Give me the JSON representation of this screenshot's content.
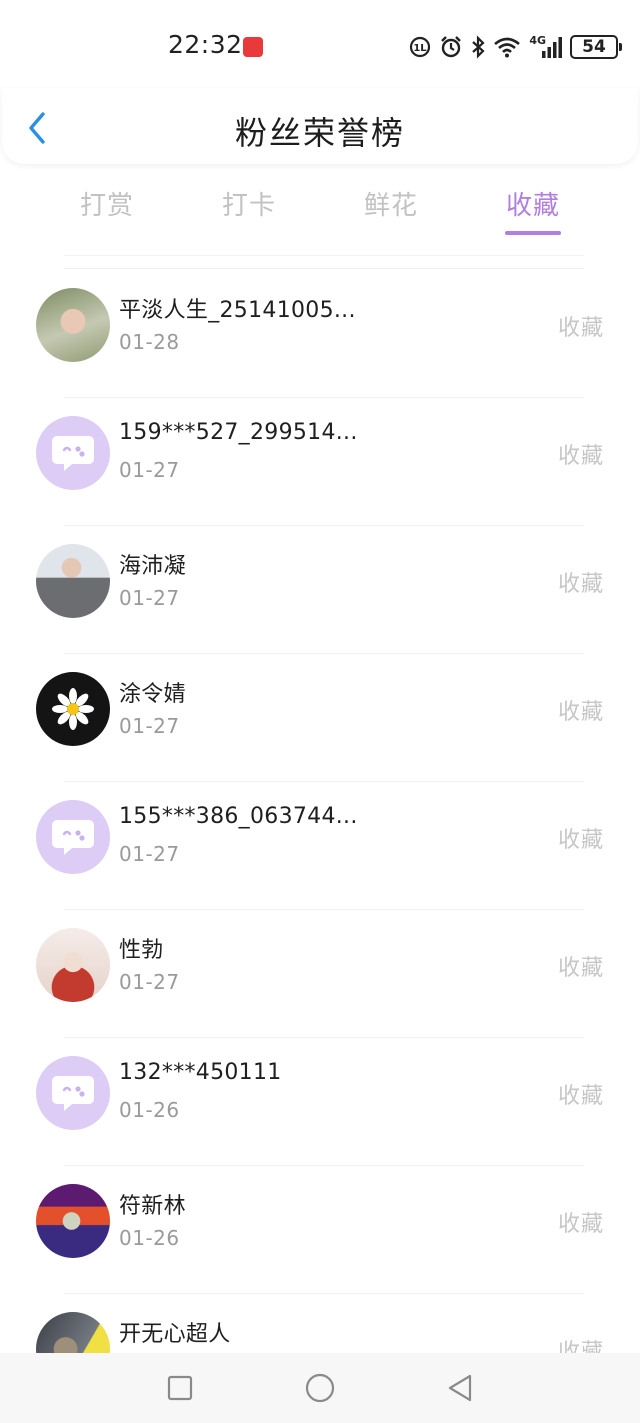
{
  "status_bar": {
    "time": "22:32",
    "battery": "54",
    "network": "4G",
    "icons": [
      "app-badge-icon",
      "hd-volte-icon",
      "alarm-icon",
      "bluetooth-icon",
      "wifi-icon",
      "signal-icon",
      "battery-icon"
    ]
  },
  "header": {
    "title": "粉丝荣誉榜",
    "back_icon": "chevron-left-icon"
  },
  "tabs": [
    {
      "label": "打赏",
      "active": false
    },
    {
      "label": "打卡",
      "active": false
    },
    {
      "label": "鲜花",
      "active": false
    },
    {
      "label": "收藏",
      "active": true
    }
  ],
  "list": [
    {
      "name": "平淡人生_25141005...",
      "date": "01-28",
      "action": "收藏",
      "avatar": "photo-avatar"
    },
    {
      "name": "159***527_299514...",
      "date": "01-27",
      "action": "收藏",
      "avatar": "default-chat-avatar"
    },
    {
      "name": "海沛凝",
      "date": "01-27",
      "action": "收藏",
      "avatar": "photo-avatar"
    },
    {
      "name": "涂令婧",
      "date": "01-27",
      "action": "收藏",
      "avatar": "daisy-avatar"
    },
    {
      "name": "155***386_063744...",
      "date": "01-27",
      "action": "收藏",
      "avatar": "default-chat-avatar"
    },
    {
      "name": "性勃",
      "date": "01-27",
      "action": "收藏",
      "avatar": "anime-avatar"
    },
    {
      "name": "132***450111",
      "date": "01-26",
      "action": "收藏",
      "avatar": "default-chat-avatar"
    },
    {
      "name": "符新林",
      "date": "01-26",
      "action": "收藏",
      "avatar": "colorful-avatar"
    },
    {
      "name": "开无心超人",
      "date": "",
      "action": "收藏",
      "avatar": "photo-avatar"
    }
  ],
  "nav_bar": {
    "icons": [
      "recent-apps-icon",
      "home-icon",
      "back-icon"
    ]
  },
  "colors": {
    "accent": "#b07fe0",
    "default_avatar_bg": "#ddccf5",
    "muted_text": "#9a9a9a",
    "action_text": "#c6c6c6"
  }
}
